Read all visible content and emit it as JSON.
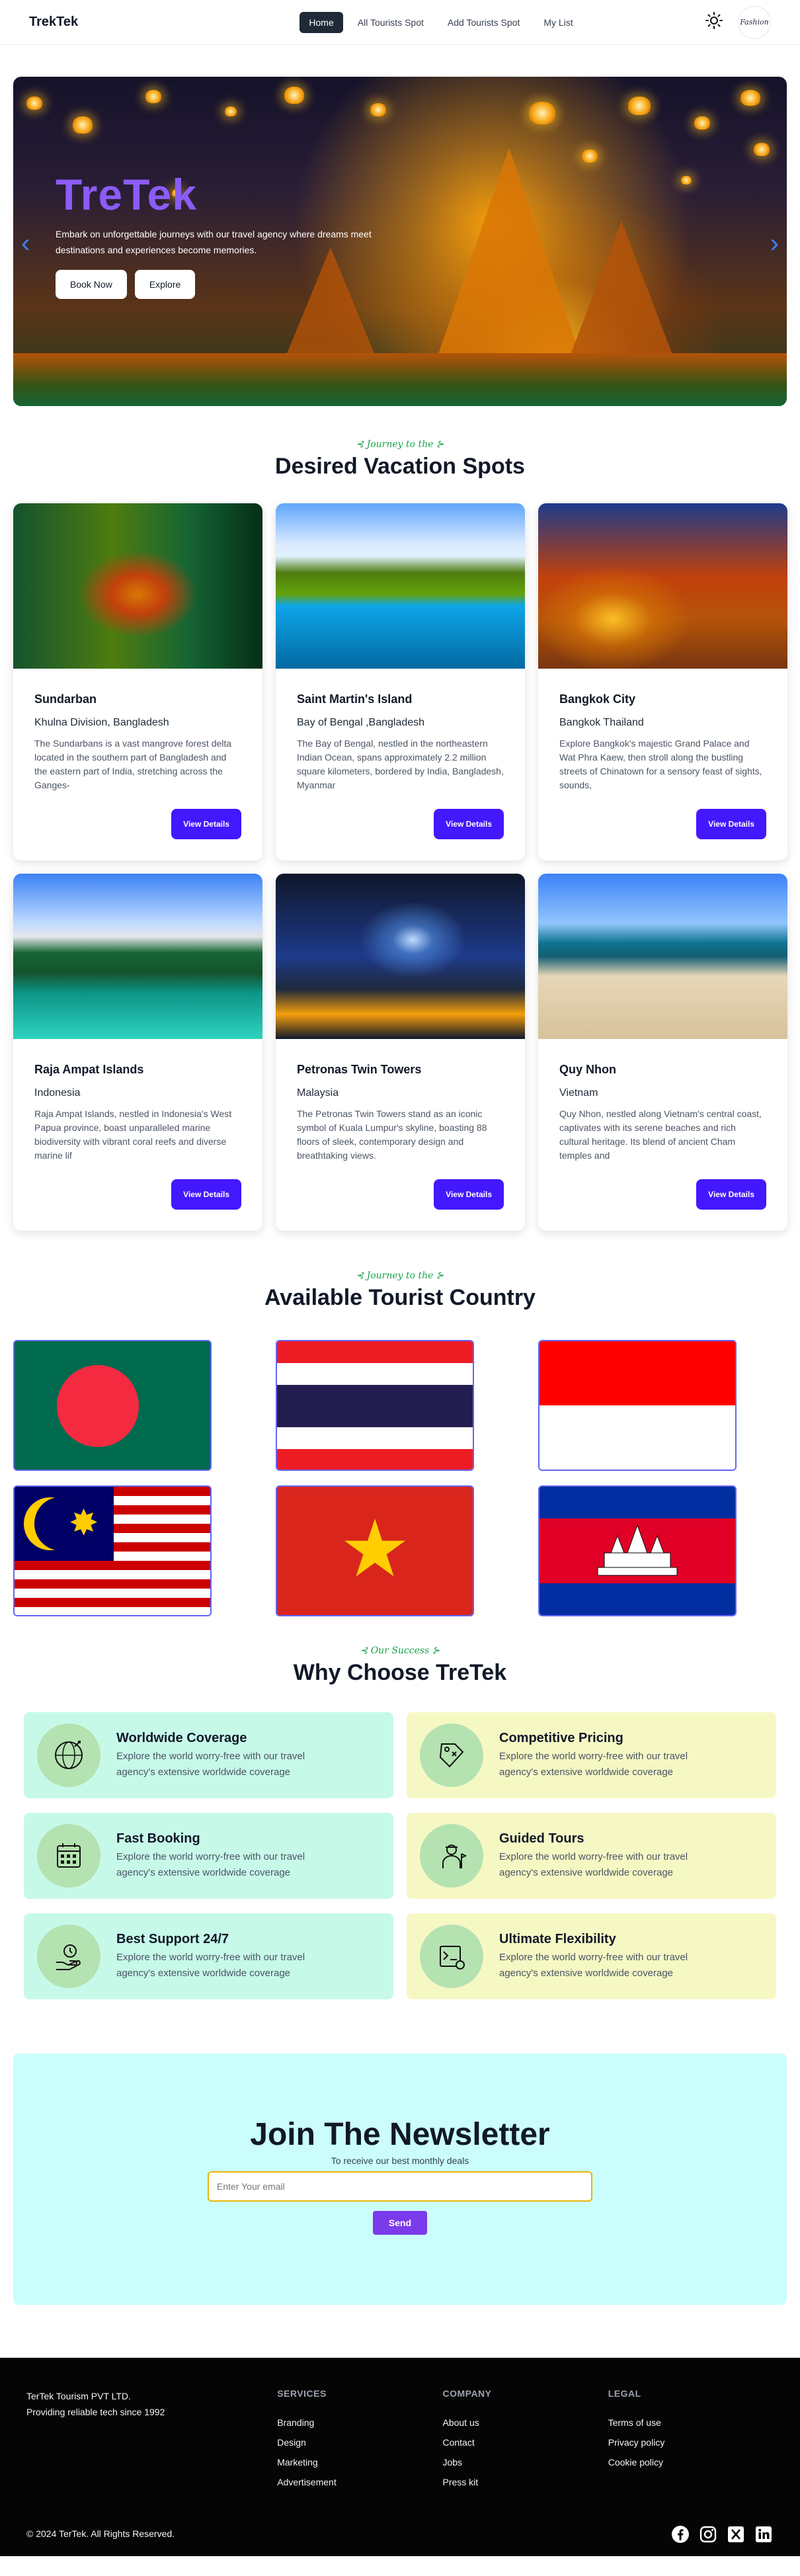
{
  "nav": {
    "brand": "TrekTek",
    "links": [
      "Home",
      "All Tourists Spot",
      "Add Tourists Spot",
      "My List"
    ],
    "active_link": "Home",
    "avatar_text": "Fashion",
    "theme_icon": "sun-icon"
  },
  "hero": {
    "title": "TreTek",
    "text": "Embark on unforgettable journeys with our travel agency where dreams meet destinations and experiences become memories.",
    "primary_button": "Book Now",
    "secondary_button": "Explore",
    "prev_icon": "chevron-left-icon",
    "next_icon": "chevron-right-icon"
  },
  "spots_section": {
    "subtitle": "Journey to the",
    "title": "Desired Vacation Spots",
    "button_label": "View Details",
    "cards": [
      {
        "title": "Sundarban",
        "location": "Khulna Division, Bangladesh",
        "description": "The Sundarbans is a vast mangrove forest delta located in the southern part of Bangladesh and the eastern part of India, stretching across the Ganges-"
      },
      {
        "title": "Saint Martin's Island",
        "location": "Bay of Bengal ,Bangladesh",
        "description": "The Bay of Bengal, nestled in the northeastern Indian Ocean, spans approximately 2.2 million square kilometers, bordered by India, Bangladesh, Myanmar"
      },
      {
        "title": "Bangkok City",
        "location": "Bangkok Thailand",
        "description": "Explore Bangkok's majestic Grand Palace and Wat Phra Kaew, then stroll along the bustling streets of Chinatown for a sensory feast of sights, sounds,"
      },
      {
        "title": "Raja Ampat Islands",
        "location": "Indonesia",
        "description": "Raja Ampat Islands, nestled in Indonesia's West Papua province, boast unparalleled marine biodiversity with vibrant coral reefs and diverse marine lif"
      },
      {
        "title": "Petronas Twin Towers",
        "location": "Malaysia",
        "description": "The Petronas Twin Towers stand as an iconic symbol of Kuala Lumpur's skyline, boasting 88 floors of sleek, contemporary design and breathtaking views."
      },
      {
        "title": "Quy Nhon",
        "location": "Vietnam",
        "description": "Quy Nhon, nestled along Vietnam's central coast, captivates with its serene beaches and rich cultural heritage. Its blend of ancient Cham temples and"
      }
    ]
  },
  "country_section": {
    "subtitle": "Journey to the",
    "title": "Available Tourist Country",
    "flags": [
      "bangladesh-flag",
      "thailand-flag",
      "indonesia-flag",
      "malaysia-flag",
      "vietnam-flag",
      "cambodia-flag"
    ]
  },
  "why_section": {
    "subtitle": "Our Success",
    "title": "Why Choose TreTek",
    "features": [
      {
        "title": "Worldwide Coverage",
        "text": "Explore the world worry-free with our travel agency's extensive worldwide coverage",
        "icon": "globe-icon"
      },
      {
        "title": "Competitive Pricing",
        "text": "Explore the world worry-free with our travel agency's extensive worldwide coverage",
        "icon": "price-tag-icon"
      },
      {
        "title": "Fast Booking",
        "text": "Explore the world worry-free with our travel agency's extensive worldwide coverage",
        "icon": "calendar-icon"
      },
      {
        "title": "Guided Tours",
        "text": "Explore the world worry-free with our travel agency's extensive worldwide coverage",
        "icon": "tour-guide-icon"
      },
      {
        "title": "Best Support 24/7",
        "text": "Explore the world worry-free with our travel agency's extensive worldwide coverage",
        "icon": "support-icon"
      },
      {
        "title": "Ultimate Flexibility",
        "text": "Explore the world worry-free with our travel agency's extensive worldwide coverage",
        "icon": "flexibility-icon"
      }
    ]
  },
  "newsletter": {
    "title": "Join The Newsletter",
    "subtitle": "To receive our best monthly deals",
    "placeholder": "Enter Your email",
    "button": "Send"
  },
  "footer": {
    "company_name": "TerTek Tourism PVT LTD.",
    "tagline": "Providing reliable tech since 1992",
    "columns": [
      {
        "title": "Services",
        "links": [
          "Branding",
          "Design",
          "Marketing",
          "Advertisement"
        ]
      },
      {
        "title": "Company",
        "links": [
          "About us",
          "Contact",
          "Jobs",
          "Press kit"
        ]
      },
      {
        "title": "Legal",
        "links": [
          "Terms of use",
          "Privacy policy",
          "Cookie policy"
        ]
      }
    ],
    "copyright": "© 2024 TerTek. All Rights Reserved.",
    "socials": [
      "facebook-icon",
      "instagram-icon",
      "x-icon",
      "linkedin-icon"
    ]
  },
  "colors": {
    "primary": "#4318ff",
    "hero_title": "#8b5cf6",
    "nav_active": "#1f2937",
    "accent_green": "#16a34a",
    "newsletter_bg": "#cafdfb",
    "feature_mint": "#c7f9e9",
    "feature_cream": "#f6f8c4"
  }
}
